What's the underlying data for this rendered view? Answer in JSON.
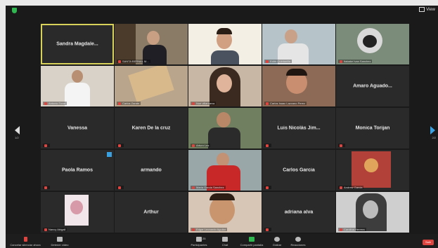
{
  "window": {
    "view_label": "View"
  },
  "nav": {
    "page_left": "1/2",
    "page_right": "2/2"
  },
  "participants": [
    {
      "name": "Sandra Magdale...",
      "caption": ""
    },
    {
      "name": "",
      "caption": "SANTA BERNAL M..."
    },
    {
      "name": "",
      "caption": ""
    },
    {
      "name": "",
      "caption": "Edith Quintanilla"
    },
    {
      "name": "",
      "caption": "Itabake Ivan Sanchez"
    },
    {
      "name": "",
      "caption": "Antonio Tovar"
    },
    {
      "name": "",
      "caption": "Carlos Zarate"
    },
    {
      "name": "",
      "caption": "Noe villanueva"
    },
    {
      "name": "",
      "caption": "Carlos Isaac Lazcano Perez"
    },
    {
      "name": "Amaro Aguado...",
      "caption": ""
    },
    {
      "name": "Vanessa",
      "caption": ""
    },
    {
      "name": "Karen De la cruz",
      "caption": ""
    },
    {
      "name": "",
      "caption": "Arturo Lez"
    },
    {
      "name": "Luis Nicolás Jim...",
      "caption": ""
    },
    {
      "name": "Monica Torijan",
      "caption": ""
    },
    {
      "name": "Paola Ramos",
      "caption": ""
    },
    {
      "name": "armando",
      "caption": ""
    },
    {
      "name": "",
      "caption": "Maria Garcia Sanchez"
    },
    {
      "name": "Carlos Garcia",
      "caption": ""
    },
    {
      "name": "",
      "caption": "Andrew Garcia"
    },
    {
      "name": "",
      "caption": "Nancy Abigail"
    },
    {
      "name": "Arthur",
      "caption": ""
    },
    {
      "name": "",
      "caption": "Edgar Leonardo Aguilar"
    },
    {
      "name": "adriana alva",
      "caption": ""
    },
    {
      "name": "",
      "caption": "Carolina Herrera"
    }
  ],
  "toolbar": {
    "mute": "Cancelar silenciar ahora",
    "video": "Detener video",
    "participants": "Participantes",
    "participants_count": "25",
    "chat": "Chat",
    "share": "Compartir pantalla",
    "record": "Grabar",
    "reactions": "Reacciones",
    "end": "Salir"
  },
  "colors": {
    "active_speaker": "#d8d25a",
    "share_green": "#2fb84f",
    "end_red": "#e0443e",
    "muted_red": "#e0443e"
  }
}
